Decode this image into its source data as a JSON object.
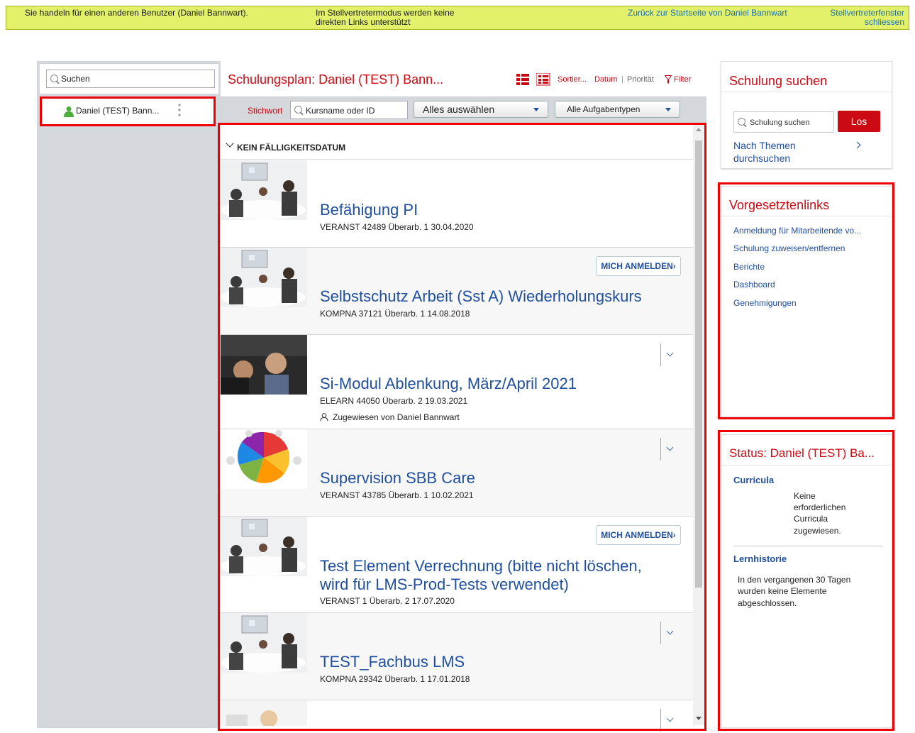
{
  "banner": {
    "impersonation_text": "Sie handeln für einen anderen Benutzer (Daniel Bannwart).",
    "deputy_note_line1": "Im Stellvertretermodus werden keine",
    "deputy_note_line2": "direkten Links unterstützt",
    "back_link": "Zurück zur Startseite von Daniel Bannwart",
    "close_line1": "Stellvertreterfenster",
    "close_line2": "schliessen"
  },
  "left": {
    "search_placeholder": "Suchen",
    "user_name": "Daniel (TEST) Bann..."
  },
  "plan": {
    "title": "Schulungsplan: Daniel (TEST) Bann...",
    "sort_label": "Sortier...",
    "sort_date": "Datum",
    "sort_sep": "|",
    "sort_priority": "Priorität",
    "filter_label": "Filter",
    "keyword_label": "Stichwort",
    "keyword_placeholder": "Kursname oder ID",
    "select_all": "Alles auswählen",
    "task_types": "Alle Aufgabentypen",
    "group_label": "KEIN FÄLLIGKEITSDATUM"
  },
  "courses": [
    {
      "title": "Befähigung PI",
      "meta": "VERANST 42489 Überarb. 1 30.04.2020"
    },
    {
      "title": "Selbstschutz Arbeit (Sst A) Wiederholungskurs",
      "meta": "KOMPNA 37121 Überarb. 1 14.08.2018",
      "button": "MICH ANMELDEN"
    },
    {
      "title": "Si-Modul Ablenkung, März/April 2021",
      "meta": "ELEARN 44050 Überarb. 2 19.03.2021",
      "assigned": "Zugewiesen von Daniel Bannwart"
    },
    {
      "title": "Supervision SBB Care",
      "meta": "VERANST 43785 Überarb. 1 10.02.2021"
    },
    {
      "title_line1": "Test Element Verrechnung (bitte nicht löschen,",
      "title_line2": "wird für LMS-Prod-Tests verwendet)",
      "meta": "VERANST 1 Überarb. 2 17.07.2020",
      "button": "MICH ANMELDEN"
    },
    {
      "title": "TEST_Fachbus LMS",
      "meta": "KOMPNA 29342 Überarb. 1 17.01.2018"
    }
  ],
  "search_panel": {
    "title": "Schulung suchen",
    "placeholder": "Schulung suchen",
    "go": "Los",
    "topics_line1": "Nach Themen",
    "topics_line2": "durchsuchen"
  },
  "manager_links": {
    "title": "Vorgesetztenlinks",
    "items": [
      "Anmeldung für Mitarbeitende vo...",
      "Schulung zuweisen/entfernen",
      "Berichte",
      "Dashboard",
      "Genehmigungen"
    ]
  },
  "status": {
    "title": "Status: Daniel (TEST) Ba...",
    "curricula_label": "Curricula",
    "curricula_l1": "Keine",
    "curricula_l2": "erforderlichen",
    "curricula_l3": "Curricula",
    "curricula_l4": "zugewiesen.",
    "history_label": "Lernhistorie",
    "history_l1": "In den vergangenen 30 Tagen",
    "history_l2": "wurden keine Elemente",
    "history_l3": "abgeschlossen."
  },
  "colors": {
    "accent_red": "#cc0a14",
    "link_blue": "#1f4f9e",
    "banner_yellow": "#e2f06a",
    "highlight_red": "#ee0000"
  }
}
